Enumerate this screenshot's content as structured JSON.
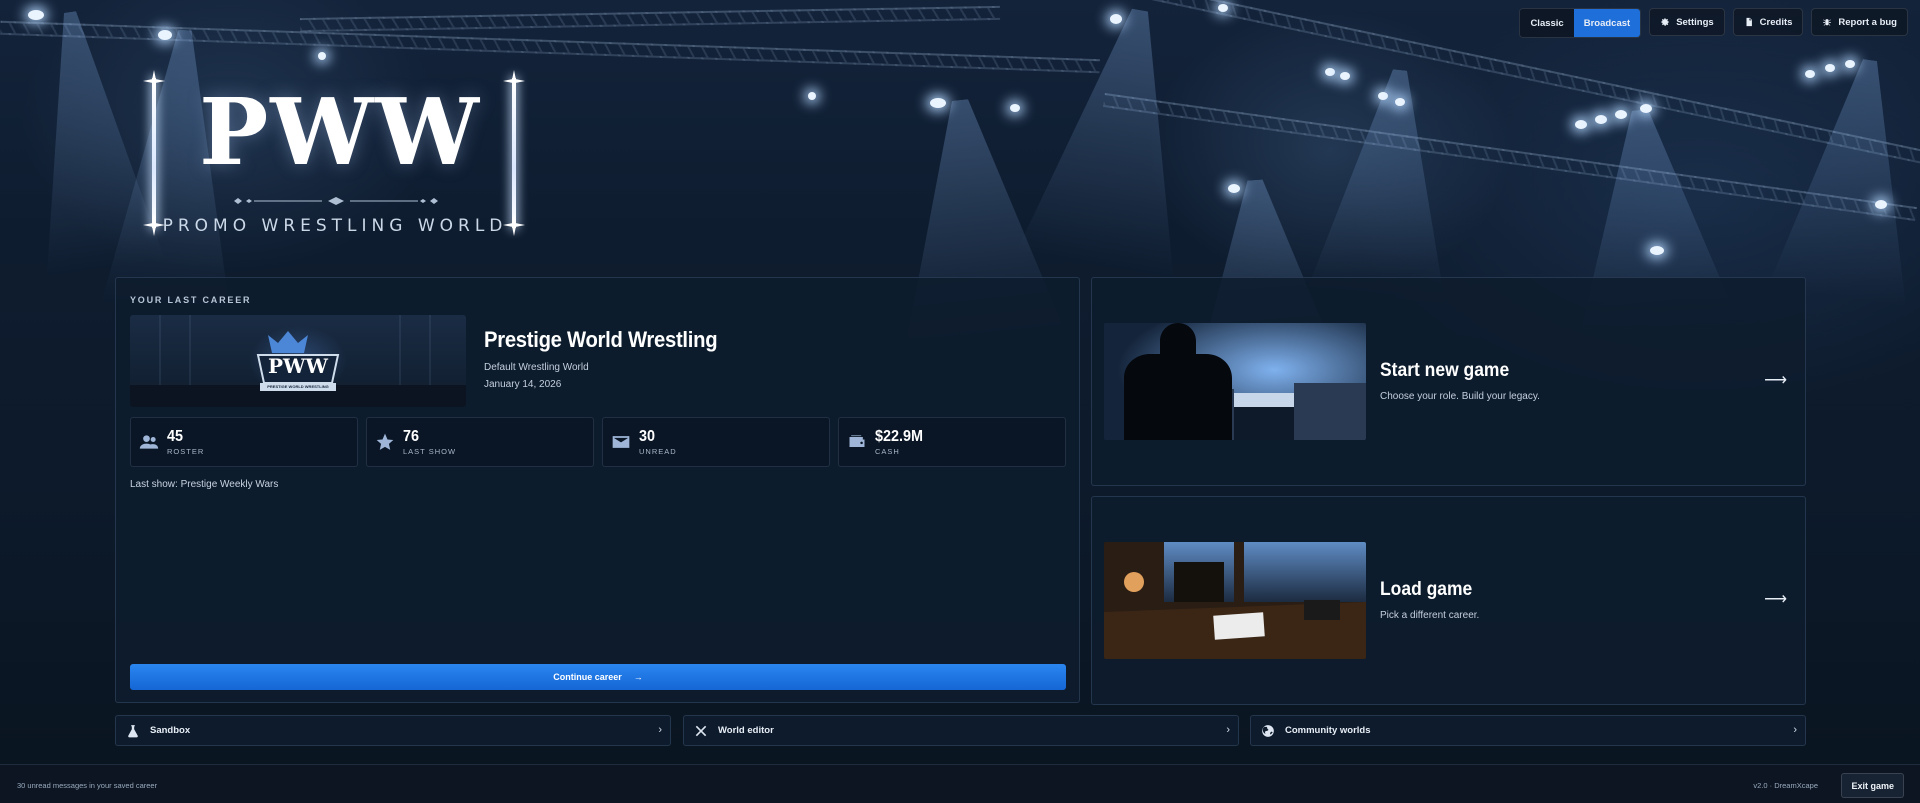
{
  "topbar": {
    "theme_classic": "Classic",
    "theme_broadcast": "Broadcast",
    "settings": "Settings",
    "credits": "Credits",
    "report_bug": "Report a bug"
  },
  "logo": {
    "mark": "PWW",
    "subtitle": "PROMO WRESTLING WORLD"
  },
  "career": {
    "kicker": "YOUR LAST CAREER",
    "thumb_mark": "PWW",
    "thumb_banner": "PRESTIGE WORLD WRESTLING",
    "title": "Prestige World Wrestling",
    "world": "Default Wrestling World",
    "date": "January 14, 2026",
    "stats": [
      {
        "icon": "users-icon",
        "value": "45",
        "label": "ROSTER"
      },
      {
        "icon": "star-icon",
        "value": "76",
        "label": "LAST SHOW"
      },
      {
        "icon": "mail-icon",
        "value": "30",
        "label": "UNREAD"
      },
      {
        "icon": "wallet-icon",
        "value": "$22.9M",
        "label": "CASH"
      }
    ],
    "last_show": "Last show: Prestige Weekly Wars",
    "continue_label": "Continue career",
    "continue_arrow": "→"
  },
  "actions": {
    "new_title": "Start new game",
    "new_desc": "Choose your role. Build your legacy.",
    "load_title": "Load game",
    "load_desc": "Pick a different career.",
    "arrow": "⟶"
  },
  "mini": {
    "sandbox": "Sandbox",
    "world_editor": "World editor",
    "community": "Community worlds",
    "chevron": "›"
  },
  "footer": {
    "status": "30 unread messages in your saved career",
    "version": "v2.0 · DreamXcape",
    "exit": "Exit game"
  },
  "colors": {
    "accent": "#1f6fdb",
    "background": "#0b1624",
    "panel": "#0e1c2e"
  }
}
